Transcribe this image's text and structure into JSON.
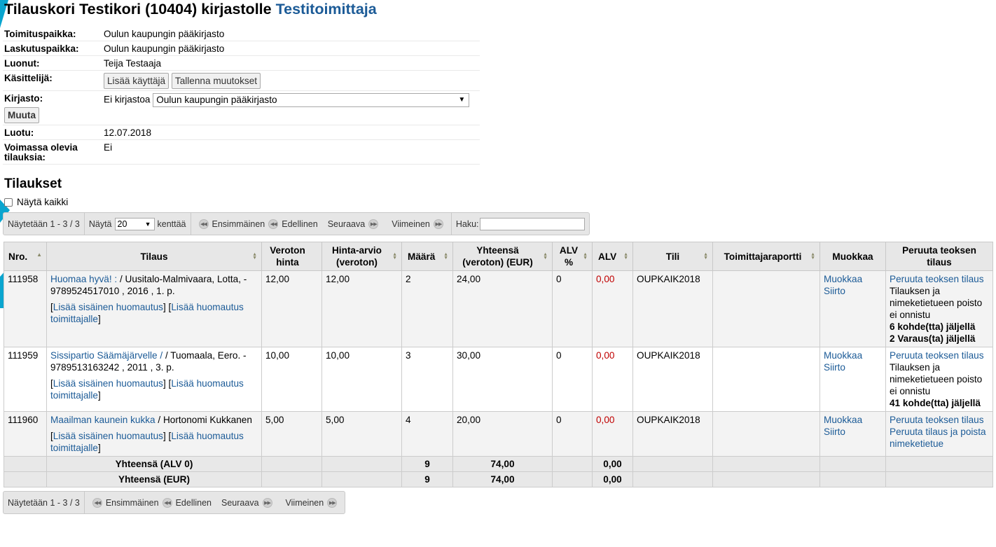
{
  "header": {
    "title_prefix": "Tilauskori Testikori (10404) kirjastolle",
    "supplier": "Testitoimittaja"
  },
  "info": {
    "delivery_label": "Toimituspaikka:",
    "delivery_value": "Oulun kaupungin pääkirjasto",
    "billing_label": "Laskutuspaikka:",
    "billing_value": "Oulun kaupungin pääkirjasto",
    "creator_label": "Luonut:",
    "creator_value": "Teija Testaaja",
    "handler_label": "Käsittelijä:",
    "add_user_button": "Lisää käyttäjä",
    "save_changes_button": "Tallenna muutokset",
    "library_label": "Kirjasto:",
    "library_current": "Ei kirjastoa",
    "library_select_value": "Oulun kaupungin pääkirjasto",
    "change_button": "Muuta",
    "created_label": "Luotu:",
    "created_value": "12.07.2018",
    "open_orders_label": "Voimassa olevia tilauksia:",
    "open_orders_value": "Ei"
  },
  "orders_section": {
    "title": "Tilaukset",
    "show_all_label": "Näytä kaikki"
  },
  "pager": {
    "showing": "Näytetään 1 - 3 / 3",
    "show_label": "Näytä",
    "per_page": "20",
    "entries_label": "kenttää",
    "first": "Ensimmäinen",
    "previous": "Edellinen",
    "next": "Seuraava",
    "last": "Viimeinen",
    "search_label": "Haku:"
  },
  "table": {
    "headers": {
      "nro": "Nro.",
      "order": "Tilaus",
      "price_excl": "Veroton hinta",
      "estimate": "Hinta-arvio (veroton)",
      "quantity": "Määrä",
      "total": "Yhteensä (veroton) (EUR)",
      "vat_pct": "ALV %",
      "vat": "ALV",
      "account": "Tili",
      "supplier_report": "Toimittajaraportti",
      "edit": "Muokkaa",
      "cancel": "Peruuta teoksen tilaus"
    },
    "add_internal_note": "Lisää sisäinen huomautus",
    "add_vendor_note": "Lisää huomautus toimittajalle",
    "rows": [
      {
        "nro": "111958",
        "title": "Huomaa hyvä! :",
        "details": " / Uusitalo-Malmivaara, Lotta, - 9789524517010 , 2016 , 1. p.",
        "price": "12,00",
        "estimate": "12,00",
        "quantity": "2",
        "total": "24,00",
        "vat_pct": "0",
        "vat": "0,00",
        "account": "OUPKAIK2018",
        "supplier_report": "",
        "edit": "Muokkaa",
        "transfer": "Siirto",
        "cancel_link": "Peruuta teoksen tilaus",
        "cancel_note": "Tilauksen ja nimeketietueen poisto ei onnistu",
        "items_left": "6 kohde(tta) jäljellä",
        "holds_left": "2 Varaus(ta) jäljellä",
        "cancel_delete": ""
      },
      {
        "nro": "111959",
        "title": "Sissipartio Säämäjärvelle /",
        "details": " / Tuomaala, Eero. - 9789513163242 , 2011 , 3. p.",
        "price": "10,00",
        "estimate": "10,00",
        "quantity": "3",
        "total": "30,00",
        "vat_pct": "0",
        "vat": "0,00",
        "account": "OUPKAIK2018",
        "supplier_report": "",
        "edit": "Muokkaa",
        "transfer": "Siirto",
        "cancel_link": "Peruuta teoksen tilaus",
        "cancel_note": "Tilauksen ja nimeketietueen poisto ei onnistu",
        "items_left": "41 kohde(tta) jäljellä",
        "holds_left": "",
        "cancel_delete": ""
      },
      {
        "nro": "111960",
        "title": "Maailman kaunein kukka",
        "details": " / Hortonomi Kukkanen",
        "price": "5,00",
        "estimate": "5,00",
        "quantity": "4",
        "total": "20,00",
        "vat_pct": "0",
        "vat": "0,00",
        "account": "OUPKAIK2018",
        "supplier_report": "",
        "edit": "Muokkaa",
        "transfer": "Siirto",
        "cancel_link": "Peruuta teoksen tilaus",
        "cancel_note": "",
        "items_left": "",
        "holds_left": "",
        "cancel_delete": "Peruuta tilaus ja poista nimeketietue"
      }
    ],
    "footer": [
      {
        "label": "Yhteensä (ALV 0)",
        "quantity": "9",
        "total": "74,00",
        "vat": "0,00"
      },
      {
        "label": "Yhteensä (EUR)",
        "quantity": "9",
        "total": "74,00",
        "vat": "0,00"
      }
    ]
  },
  "colors": {
    "link": "#1c5b97",
    "vat_red": "#c00000",
    "header_bg": "#e7e7e7",
    "accent_cyan": "#00a9d6"
  }
}
